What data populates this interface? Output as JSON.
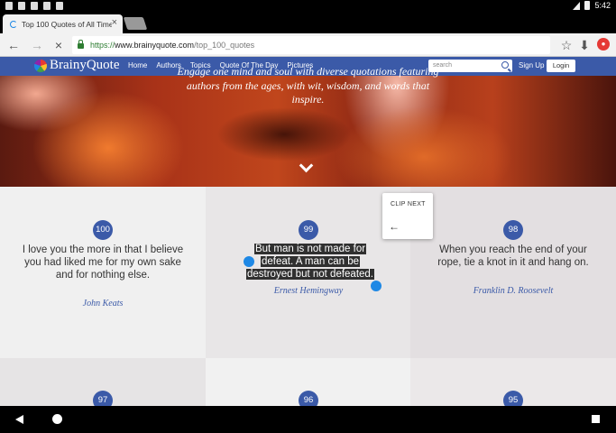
{
  "status_bar": {
    "time": "5:42"
  },
  "browser": {
    "tab_title": "Top 100 Quotes of All Time",
    "url_scheme": "https://",
    "url_host": "www.brainyquote.com",
    "url_path": "/top_100_quotes"
  },
  "site": {
    "logo": "BrainyQuote",
    "nav": [
      "Home",
      "Authors",
      "Topics",
      "Quote Of The Day",
      "Pictures"
    ],
    "search_placeholder": "search",
    "signup": "Sign Up",
    "login": "Login"
  },
  "hero": {
    "line1": "Engage one mind and soul with diverse quotations featuring",
    "line2": "authors from the ages, with wit, wisdom, and words that",
    "line3": "inspire."
  },
  "quotes": [
    {
      "rank": "100",
      "text": "I love you the more in that I believe you had liked me for my own sake and for nothing else.",
      "author": "John Keats"
    },
    {
      "rank": "99",
      "text_lines": [
        "But man is not made for",
        "defeat. A man can be",
        "destroyed but not defeated."
      ],
      "author": "Ernest Hemingway"
    },
    {
      "rank": "98",
      "text": "When you reach the end of your rope, tie a knot in it and hang on.",
      "author": "Franklin D. Roosevelt"
    },
    {
      "rank": "97"
    },
    {
      "rank": "96"
    },
    {
      "rank": "95"
    }
  ],
  "clip_popup": {
    "label": "CLIP NEXT"
  },
  "colors": {
    "brand": "#3b5aa8",
    "selection_handle": "#1e88e5"
  }
}
